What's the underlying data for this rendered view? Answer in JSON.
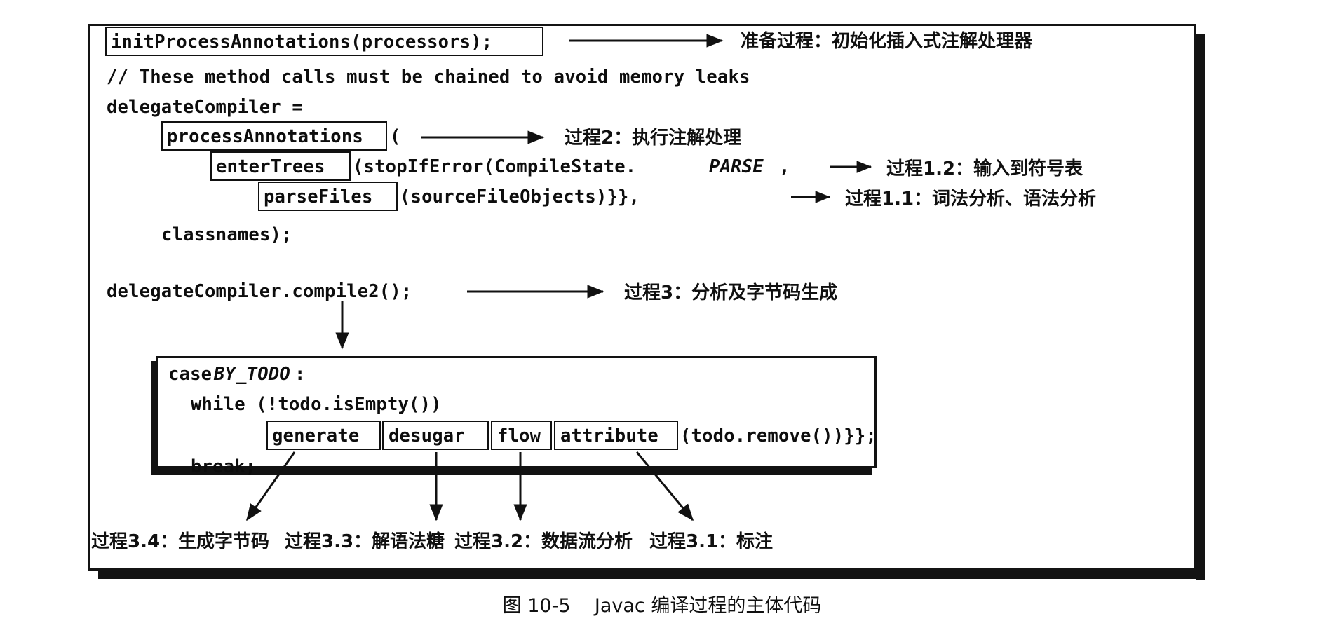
{
  "figure": {
    "caption": "图 10-5    Javac 编译过程的主体代码",
    "border_color": "#141414",
    "text_color": "#0d0d0d"
  },
  "code": {
    "line1_boxed": "initProcessAnnotations(processors);",
    "line2_comment": "// These method calls must be chained to avoid memory leaks",
    "line3": "delegateCompiler =",
    "line4_boxed": "processAnnotations",
    "line4_tail": "(",
    "line5_boxed": "enterTrees",
    "line5_tail": "(stopIfError(CompileState.",
    "line5_italic": "PARSE",
    "line5_end": ",",
    "line6_boxed": "parseFiles",
    "line6_tail": "(sourceFileObjects)}},",
    "line7": "classnames);",
    "line8": "delegateCompiler.compile2();"
  },
  "casebox": {
    "line1_prefix": "case ",
    "line1_italic": "BY_TODO",
    "line1_suffix": ":",
    "line2": "while (!todo.isEmpty())",
    "boxed": [
      "generate",
      "desugar",
      "flow",
      "attribute"
    ],
    "line3_tail": "(todo.remove())}};",
    "line4": "break;"
  },
  "annotations": {
    "prepare": "准备过程：初始化插入式注解处理器",
    "process2": "过程2：执行注解处理",
    "process1_2": "过程1.2：输入到符号表",
    "process1_1": "过程1.1：词法分析、语法分析",
    "process3": "过程3：分析及字节码生成"
  },
  "bottom_labels": [
    "过程3.4：生成字节码",
    "过程3.3：解语法糖",
    "过程3.2：数据流分析",
    "过程3.1：标注"
  ]
}
